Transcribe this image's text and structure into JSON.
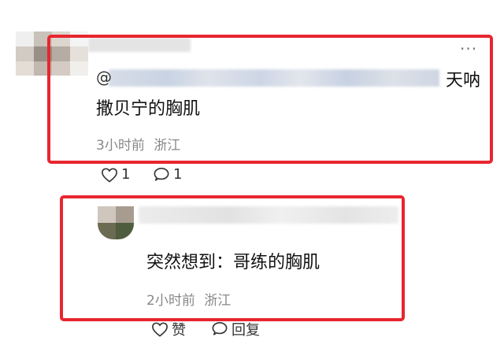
{
  "reply_prefix": "@",
  "comment1": {
    "tail_text": "天呐",
    "text": "撒贝宁的胸肌",
    "time": "3小时前",
    "location": "浙江",
    "likes": "1",
    "replies": "1",
    "more": "···"
  },
  "comment2": {
    "text": "突然想到：哥练的胸肌",
    "time": "2小时前",
    "location": "浙江",
    "like_label": "赞",
    "reply_label": "回复"
  },
  "colors": {
    "highlight_border": "#e8262f",
    "meta_text": "#888888"
  }
}
